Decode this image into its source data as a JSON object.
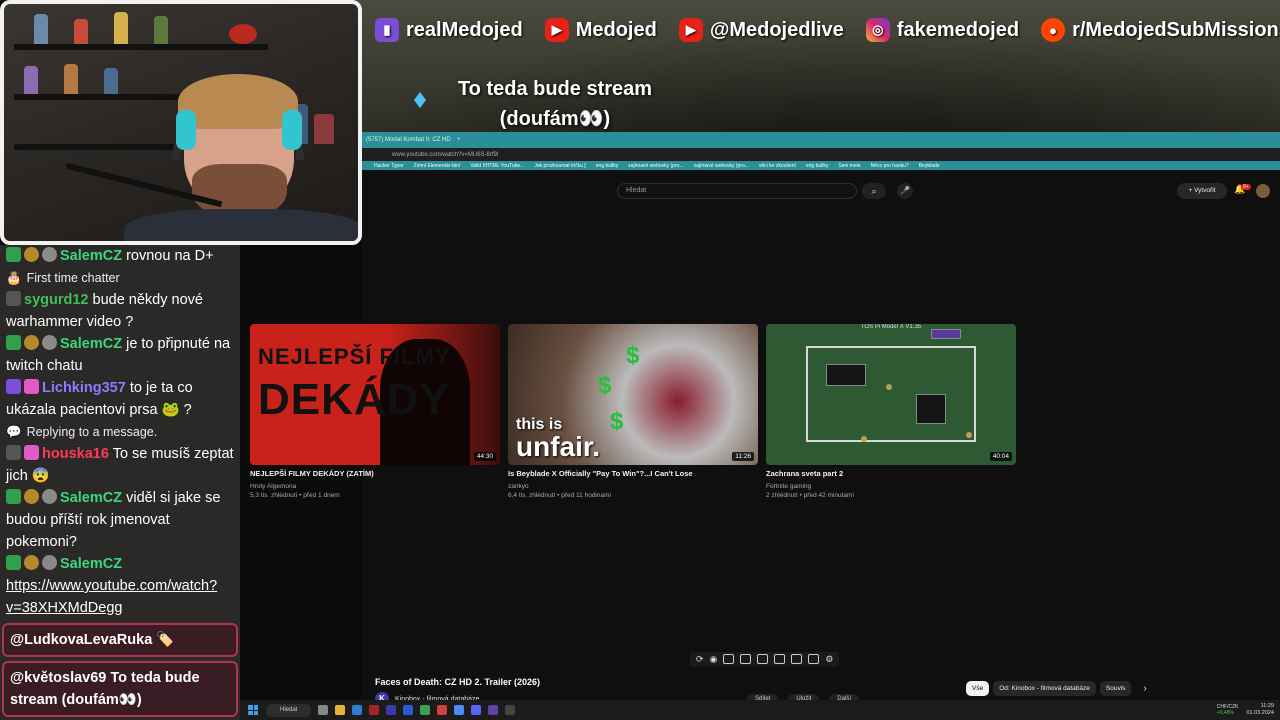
{
  "socials": [
    {
      "icon": "twitch-icon",
      "label": "realMedojed"
    },
    {
      "icon": "youtube-icon",
      "label": "Medojed"
    },
    {
      "icon": "youtube-icon",
      "label": "@Medojedlive"
    },
    {
      "icon": "instagram-icon",
      "label": "fakemedojed"
    },
    {
      "icon": "reddit-icon",
      "label": "r/MedojedSubMissions"
    }
  ],
  "stream_note": {
    "line1": "To teda bude stream",
    "line2": "(doufám👀)"
  },
  "chat": {
    "messages": [
      {
        "user": "SalemCZ",
        "color": "#3cd77a",
        "text": "rovnou na D+"
      },
      {
        "system": "First time chatter"
      },
      {
        "user": "sygurd12",
        "color": "#3fbf5a",
        "text": "bude někdy nové warhammer video ?"
      },
      {
        "user": "SalemCZ",
        "color": "#3cd77a",
        "text": "je to připnuté na twitch chatu"
      },
      {
        "user": "Lichking357",
        "color": "#8a7cff",
        "text": "to je ta co ukázala pacientovi prsa 🐸 ?"
      },
      {
        "system": "Replying to a message."
      },
      {
        "user": "houska16",
        "color": "#ff3a5e",
        "text": "To se musíš zeptat jich 😨"
      },
      {
        "user": "SalemCZ",
        "color": "#3cd77a",
        "text": "viděl si jake se budou příští rok jmenovat pokemoni?"
      },
      {
        "user": "SalemCZ",
        "color": "#3cd77a",
        "text": "https://www.youtube.com/watch?v=38XHXMdDegg"
      }
    ],
    "highlight1": "@LudkovaLevaRuka 🏷️",
    "highlight2": "@květoslav69 To teda bude stream (doufám👀)"
  },
  "browser": {
    "tab": "(5757) Mortal Kombat II: CZ HD",
    "url": "www.youtube.com/watch?v=MU6S-8rf9I",
    "bookmarks": [
      "Hacker Typer",
      "Zimní Elementár-tání",
      "Valid XHTML YouTube...",
      "Jak prozkoumat tričku [",
      "eng bullky",
      "zajímavé webovky (pro...",
      "zajímavé webovky (pro...",
      "věci ke zkoušení",
      "eng bullky",
      "Seni mele",
      "Něco pro hanku?",
      "Beyblade"
    ],
    "search_placeholder": "Hledat",
    "create_label": "Vytvořit",
    "bell_count": "9+"
  },
  "videos": [
    {
      "title": "NEJLEPŠÍ FILMY DEKÁDY (ZATÍM)",
      "channel": "Hroty Algemona",
      "meta": "5,3 tis. zhlédnutí • před 1 dnem",
      "duration": "44:30",
      "thumb_text_a": "NEJLEPŠÍ FILMY",
      "thumb_text_b": "DEKÁDY"
    },
    {
      "title": "Is Beyblade X Officially \"Pay To Win\"?...I Can't Lose",
      "channel": "zankyo",
      "meta": "6,4 tis. zhlédnutí • před 11 hodinami",
      "duration": "11:26",
      "thumb_text_a": "this is",
      "thumb_text_b": "unfair."
    },
    {
      "title": "Zachrana sveta part 2",
      "channel": "Fortnite gaming",
      "meta": "2 zhlédnutí • před 42 minutami",
      "duration": "40:04",
      "thumb_text_a": "TOS Pi  Model X V1.35"
    }
  ],
  "player": {
    "title": "Faces of Death: CZ HD 2. Trailer (2026)",
    "channel": "Kinobox - filmová databáze",
    "chips": [
      "Vše",
      "Od: Kinobox - filmová databáze",
      "Souvis"
    ],
    "actions": [
      "Sdílet",
      "Uložit",
      "Další"
    ]
  },
  "taskbar": {
    "search": "Hledat",
    "stock_label": "CHF/CZK",
    "stock_change": "+0,48%",
    "time": "11:29",
    "date": "01.03.2024"
  }
}
